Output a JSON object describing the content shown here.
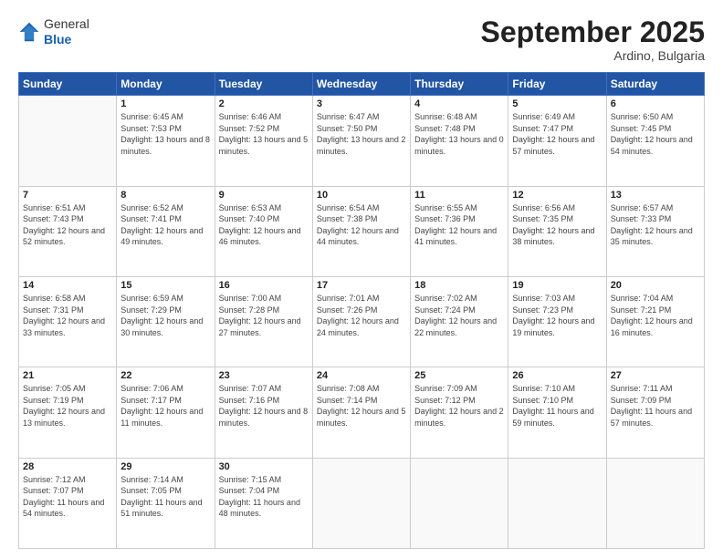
{
  "header": {
    "logo_general": "General",
    "logo_blue": "Blue",
    "month_title": "September 2025",
    "subtitle": "Ardino, Bulgaria"
  },
  "days_of_week": [
    "Sunday",
    "Monday",
    "Tuesday",
    "Wednesday",
    "Thursday",
    "Friday",
    "Saturday"
  ],
  "weeks": [
    [
      {
        "num": "",
        "sunrise": "",
        "sunset": "",
        "daylight": ""
      },
      {
        "num": "1",
        "sunrise": "Sunrise: 6:45 AM",
        "sunset": "Sunset: 7:53 PM",
        "daylight": "Daylight: 13 hours and 8 minutes."
      },
      {
        "num": "2",
        "sunrise": "Sunrise: 6:46 AM",
        "sunset": "Sunset: 7:52 PM",
        "daylight": "Daylight: 13 hours and 5 minutes."
      },
      {
        "num": "3",
        "sunrise": "Sunrise: 6:47 AM",
        "sunset": "Sunset: 7:50 PM",
        "daylight": "Daylight: 13 hours and 2 minutes."
      },
      {
        "num": "4",
        "sunrise": "Sunrise: 6:48 AM",
        "sunset": "Sunset: 7:48 PM",
        "daylight": "Daylight: 13 hours and 0 minutes."
      },
      {
        "num": "5",
        "sunrise": "Sunrise: 6:49 AM",
        "sunset": "Sunset: 7:47 PM",
        "daylight": "Daylight: 12 hours and 57 minutes."
      },
      {
        "num": "6",
        "sunrise": "Sunrise: 6:50 AM",
        "sunset": "Sunset: 7:45 PM",
        "daylight": "Daylight: 12 hours and 54 minutes."
      }
    ],
    [
      {
        "num": "7",
        "sunrise": "Sunrise: 6:51 AM",
        "sunset": "Sunset: 7:43 PM",
        "daylight": "Daylight: 12 hours and 52 minutes."
      },
      {
        "num": "8",
        "sunrise": "Sunrise: 6:52 AM",
        "sunset": "Sunset: 7:41 PM",
        "daylight": "Daylight: 12 hours and 49 minutes."
      },
      {
        "num": "9",
        "sunrise": "Sunrise: 6:53 AM",
        "sunset": "Sunset: 7:40 PM",
        "daylight": "Daylight: 12 hours and 46 minutes."
      },
      {
        "num": "10",
        "sunrise": "Sunrise: 6:54 AM",
        "sunset": "Sunset: 7:38 PM",
        "daylight": "Daylight: 12 hours and 44 minutes."
      },
      {
        "num": "11",
        "sunrise": "Sunrise: 6:55 AM",
        "sunset": "Sunset: 7:36 PM",
        "daylight": "Daylight: 12 hours and 41 minutes."
      },
      {
        "num": "12",
        "sunrise": "Sunrise: 6:56 AM",
        "sunset": "Sunset: 7:35 PM",
        "daylight": "Daylight: 12 hours and 38 minutes."
      },
      {
        "num": "13",
        "sunrise": "Sunrise: 6:57 AM",
        "sunset": "Sunset: 7:33 PM",
        "daylight": "Daylight: 12 hours and 35 minutes."
      }
    ],
    [
      {
        "num": "14",
        "sunrise": "Sunrise: 6:58 AM",
        "sunset": "Sunset: 7:31 PM",
        "daylight": "Daylight: 12 hours and 33 minutes."
      },
      {
        "num": "15",
        "sunrise": "Sunrise: 6:59 AM",
        "sunset": "Sunset: 7:29 PM",
        "daylight": "Daylight: 12 hours and 30 minutes."
      },
      {
        "num": "16",
        "sunrise": "Sunrise: 7:00 AM",
        "sunset": "Sunset: 7:28 PM",
        "daylight": "Daylight: 12 hours and 27 minutes."
      },
      {
        "num": "17",
        "sunrise": "Sunrise: 7:01 AM",
        "sunset": "Sunset: 7:26 PM",
        "daylight": "Daylight: 12 hours and 24 minutes."
      },
      {
        "num": "18",
        "sunrise": "Sunrise: 7:02 AM",
        "sunset": "Sunset: 7:24 PM",
        "daylight": "Daylight: 12 hours and 22 minutes."
      },
      {
        "num": "19",
        "sunrise": "Sunrise: 7:03 AM",
        "sunset": "Sunset: 7:23 PM",
        "daylight": "Daylight: 12 hours and 19 minutes."
      },
      {
        "num": "20",
        "sunrise": "Sunrise: 7:04 AM",
        "sunset": "Sunset: 7:21 PM",
        "daylight": "Daylight: 12 hours and 16 minutes."
      }
    ],
    [
      {
        "num": "21",
        "sunrise": "Sunrise: 7:05 AM",
        "sunset": "Sunset: 7:19 PM",
        "daylight": "Daylight: 12 hours and 13 minutes."
      },
      {
        "num": "22",
        "sunrise": "Sunrise: 7:06 AM",
        "sunset": "Sunset: 7:17 PM",
        "daylight": "Daylight: 12 hours and 11 minutes."
      },
      {
        "num": "23",
        "sunrise": "Sunrise: 7:07 AM",
        "sunset": "Sunset: 7:16 PM",
        "daylight": "Daylight: 12 hours and 8 minutes."
      },
      {
        "num": "24",
        "sunrise": "Sunrise: 7:08 AM",
        "sunset": "Sunset: 7:14 PM",
        "daylight": "Daylight: 12 hours and 5 minutes."
      },
      {
        "num": "25",
        "sunrise": "Sunrise: 7:09 AM",
        "sunset": "Sunset: 7:12 PM",
        "daylight": "Daylight: 12 hours and 2 minutes."
      },
      {
        "num": "26",
        "sunrise": "Sunrise: 7:10 AM",
        "sunset": "Sunset: 7:10 PM",
        "daylight": "Daylight: 11 hours and 59 minutes."
      },
      {
        "num": "27",
        "sunrise": "Sunrise: 7:11 AM",
        "sunset": "Sunset: 7:09 PM",
        "daylight": "Daylight: 11 hours and 57 minutes."
      }
    ],
    [
      {
        "num": "28",
        "sunrise": "Sunrise: 7:12 AM",
        "sunset": "Sunset: 7:07 PM",
        "daylight": "Daylight: 11 hours and 54 minutes."
      },
      {
        "num": "29",
        "sunrise": "Sunrise: 7:14 AM",
        "sunset": "Sunset: 7:05 PM",
        "daylight": "Daylight: 11 hours and 51 minutes."
      },
      {
        "num": "30",
        "sunrise": "Sunrise: 7:15 AM",
        "sunset": "Sunset: 7:04 PM",
        "daylight": "Daylight: 11 hours and 48 minutes."
      },
      {
        "num": "",
        "sunrise": "",
        "sunset": "",
        "daylight": ""
      },
      {
        "num": "",
        "sunrise": "",
        "sunset": "",
        "daylight": ""
      },
      {
        "num": "",
        "sunrise": "",
        "sunset": "",
        "daylight": ""
      },
      {
        "num": "",
        "sunrise": "",
        "sunset": "",
        "daylight": ""
      }
    ]
  ]
}
